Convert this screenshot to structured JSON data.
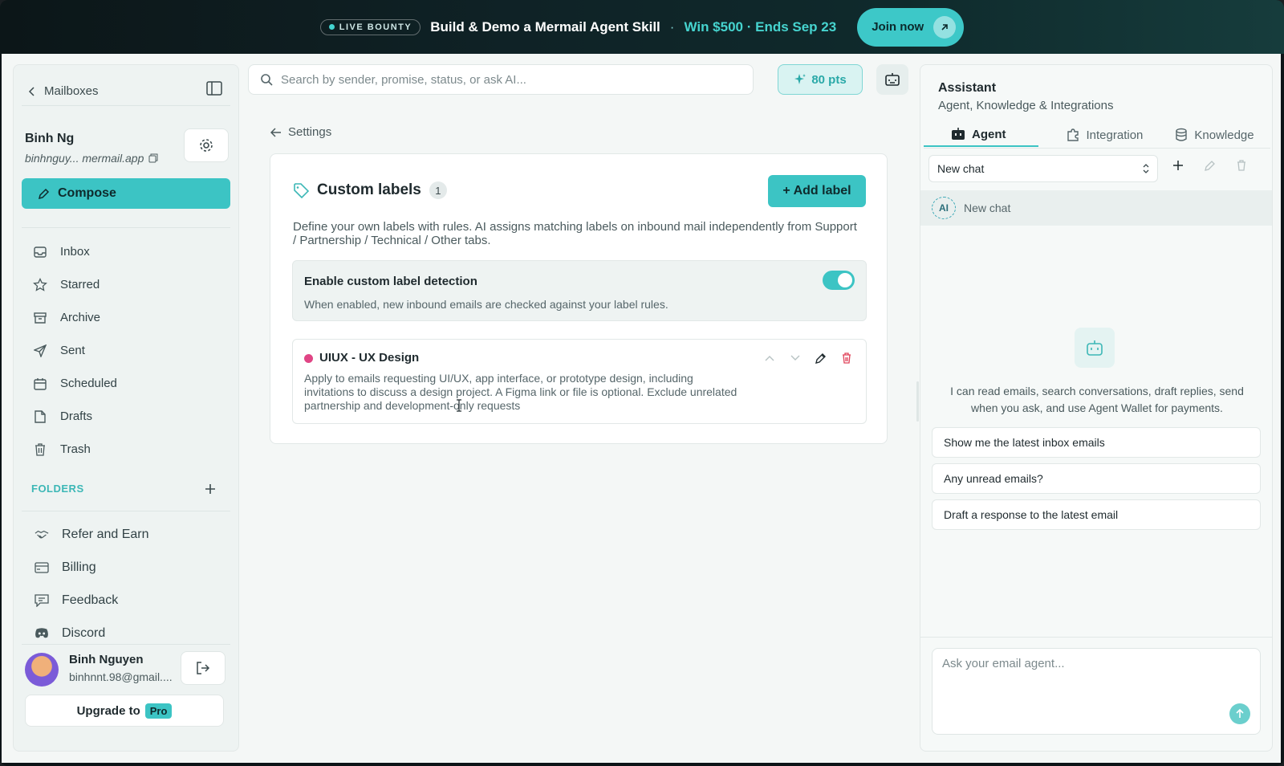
{
  "banner": {
    "badge": "LIVE BOUNTY",
    "title": "Build & Demo a Mermail Agent Skill",
    "separator": " · ",
    "win": "Win $500 · Ends Sep 23",
    "cta": "Join now"
  },
  "sidebar": {
    "back_label": "Mailboxes",
    "account_name": "Binh Ng",
    "account_email": "binhnguy... mermail.app",
    "compose_label": "Compose",
    "nav": [
      {
        "label": "Inbox",
        "icon": "inbox-icon"
      },
      {
        "label": "Starred",
        "icon": "star-icon"
      },
      {
        "label": "Archive",
        "icon": "archive-icon"
      },
      {
        "label": "Sent",
        "icon": "send-icon"
      },
      {
        "label": "Scheduled",
        "icon": "calendar-icon"
      },
      {
        "label": "Drafts",
        "icon": "file-icon"
      },
      {
        "label": "Trash",
        "icon": "trash-icon"
      }
    ],
    "folders_label": "FOLDERS",
    "extras": [
      {
        "label": "Refer and Earn",
        "icon": "handshake-icon"
      },
      {
        "label": "Billing",
        "icon": "credit-card-icon"
      },
      {
        "label": "Feedback",
        "icon": "message-icon"
      },
      {
        "label": "Discord",
        "icon": "discord-icon"
      }
    ],
    "user_name": "Binh Nguyen",
    "user_email": "binhnnt.98@gmail....",
    "upgrade_label": "Upgrade to",
    "upgrade_badge": "Pro"
  },
  "search": {
    "placeholder": "Search by sender, promise, status, or ask AI..."
  },
  "points": "80 pts",
  "breadcrumb_back": "Settings",
  "custom_labels": {
    "title": "Custom labels",
    "count": "1",
    "add_label": "+ Add label",
    "description": "Define your own labels with rules. AI assigns matching labels on inbound mail independently from Support / Partnership / Technical / Other tabs.",
    "detection_title": "Enable custom label detection",
    "detection_sub": "When enabled, new inbound emails are checked against your label rules.",
    "detection_enabled": true,
    "labels": [
      {
        "name": "UIUX - UX Design",
        "color": "#e04585",
        "rule": "Apply to emails requesting UI/UX, app interface, or prototype design, including invitations to discuss a design project. A Figma link or file is optional. Exclude unrelated partnership and development-only requests"
      }
    ]
  },
  "assistant": {
    "title": "Assistant",
    "subtitle": "Agent, Knowledge & Integrations",
    "tabs": [
      {
        "label": "Agent",
        "icon": "bot-icon"
      },
      {
        "label": "Integration",
        "icon": "puzzle-icon"
      },
      {
        "label": "Knowledge",
        "icon": "database-icon"
      }
    ],
    "chat_select": "New chat",
    "chat_row_badge": "AI",
    "chat_row_label": "New chat",
    "intro": "I can read emails, search conversations, draft replies, send when you ask, and use Agent Wallet for payments.",
    "suggestions": [
      "Show me the latest inbox emails",
      "Any unread emails?",
      "Draft a response to the latest email"
    ],
    "input_placeholder": "Ask your email agent..."
  },
  "colors": {
    "accent": "#3cc4c4",
    "label_pink": "#e04585",
    "banner_bg": "#0f2226"
  }
}
